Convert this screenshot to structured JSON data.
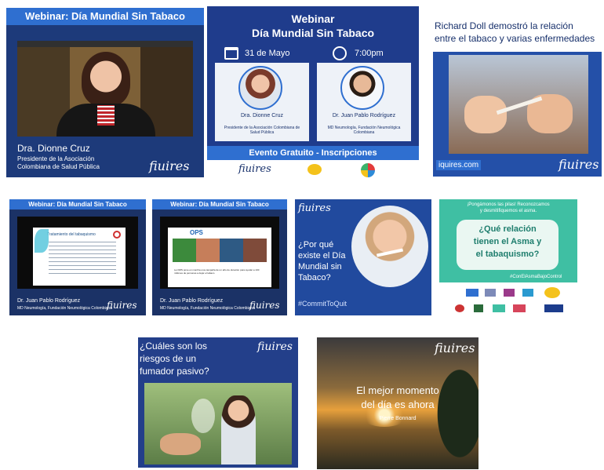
{
  "tile1": {
    "header": "Webinar:   Día Mundial Sin Tabaco",
    "speaker_name": "Dra. Dionne Cruz",
    "speaker_role": "Presidente de la Asociación Colombiana de Salud Pública",
    "logo": "fiuires"
  },
  "tile2": {
    "title_line1": "Webinar",
    "title_line2": "Día Mundial Sin Tabaco",
    "date": "31 de Mayo",
    "time": "7:00pm",
    "speaker1_name": "Dra. Dionne Cruz",
    "speaker1_role": "Presidente de la Asociación Colombiana de Salud Pública",
    "speaker2_name": "Dr. Juan Pablo Rodríguez",
    "speaker2_role": "MD Neumología, Fundación Neumológica Colombiana",
    "cta": "Evento Gratuito - Inscripciones",
    "logo": "fiuires"
  },
  "tile3": {
    "caption_line1": "Richard Doll demostró la relación",
    "caption_line2": "entre el tabaco y varias enfermedades",
    "url": "iquires.com",
    "logo": "fiuires"
  },
  "tile4": {
    "header": "Webinar:   Día Mundial Sin Tabaco",
    "slide_title": "Tratamiento del tabaquismo",
    "speaker_name": "Dr. Juan Pablo Rodríguez",
    "speaker_role": "MD Neumología, Fundación Neumológica Colombiana",
    "logo": "fiuires"
  },
  "tile5": {
    "header": "Webinar:   Día Mundial Sin Tabaco",
    "slide_brand": "OPS",
    "slide_caption": "La OMS pone en marcha una campaña de un año de duración para ayudar a 100 millones de personas a dejar el tabaco",
    "speaker_name": "Dr. Juan Pablo Rodríguez",
    "speaker_role": "MD Neumología, Fundación Neumológica Colombiana",
    "logo": "fiuires"
  },
  "tile6": {
    "question_line1": "¿Por qué",
    "question_line2": "existe el Día",
    "question_line3": "Mundial sin",
    "question_line4": "Tabaco?",
    "hashtag": "#CommitToQuit",
    "logo": "fiuires"
  },
  "tile7": {
    "top_line1": "¡Pongámonos las pilas! Reconozcamos",
    "top_line2": "y desmitifiquemos el asma.",
    "question_line1": "¿Qué relación",
    "question_line2": "tienen el Asma y",
    "question_line3": "el tabaquismo?",
    "hashtag": "#ConElAsmaBajoControl"
  },
  "tile8": {
    "question_line1": "¿Cuáles son los",
    "question_line2": "riesgos de un",
    "question_line3": "fumador pasivo?",
    "logo": "fiuires"
  },
  "tile9": {
    "quote_line1": "El mejor momento",
    "quote_line2": "del día es ahora",
    "author": "Pierre Bonnard",
    "logo": "fiuires"
  },
  "colors": {
    "header_blue": "#2f6fd0",
    "navy": "#17306b",
    "teal": "#3fbfa3",
    "accent_green": "#8fe3cf"
  }
}
